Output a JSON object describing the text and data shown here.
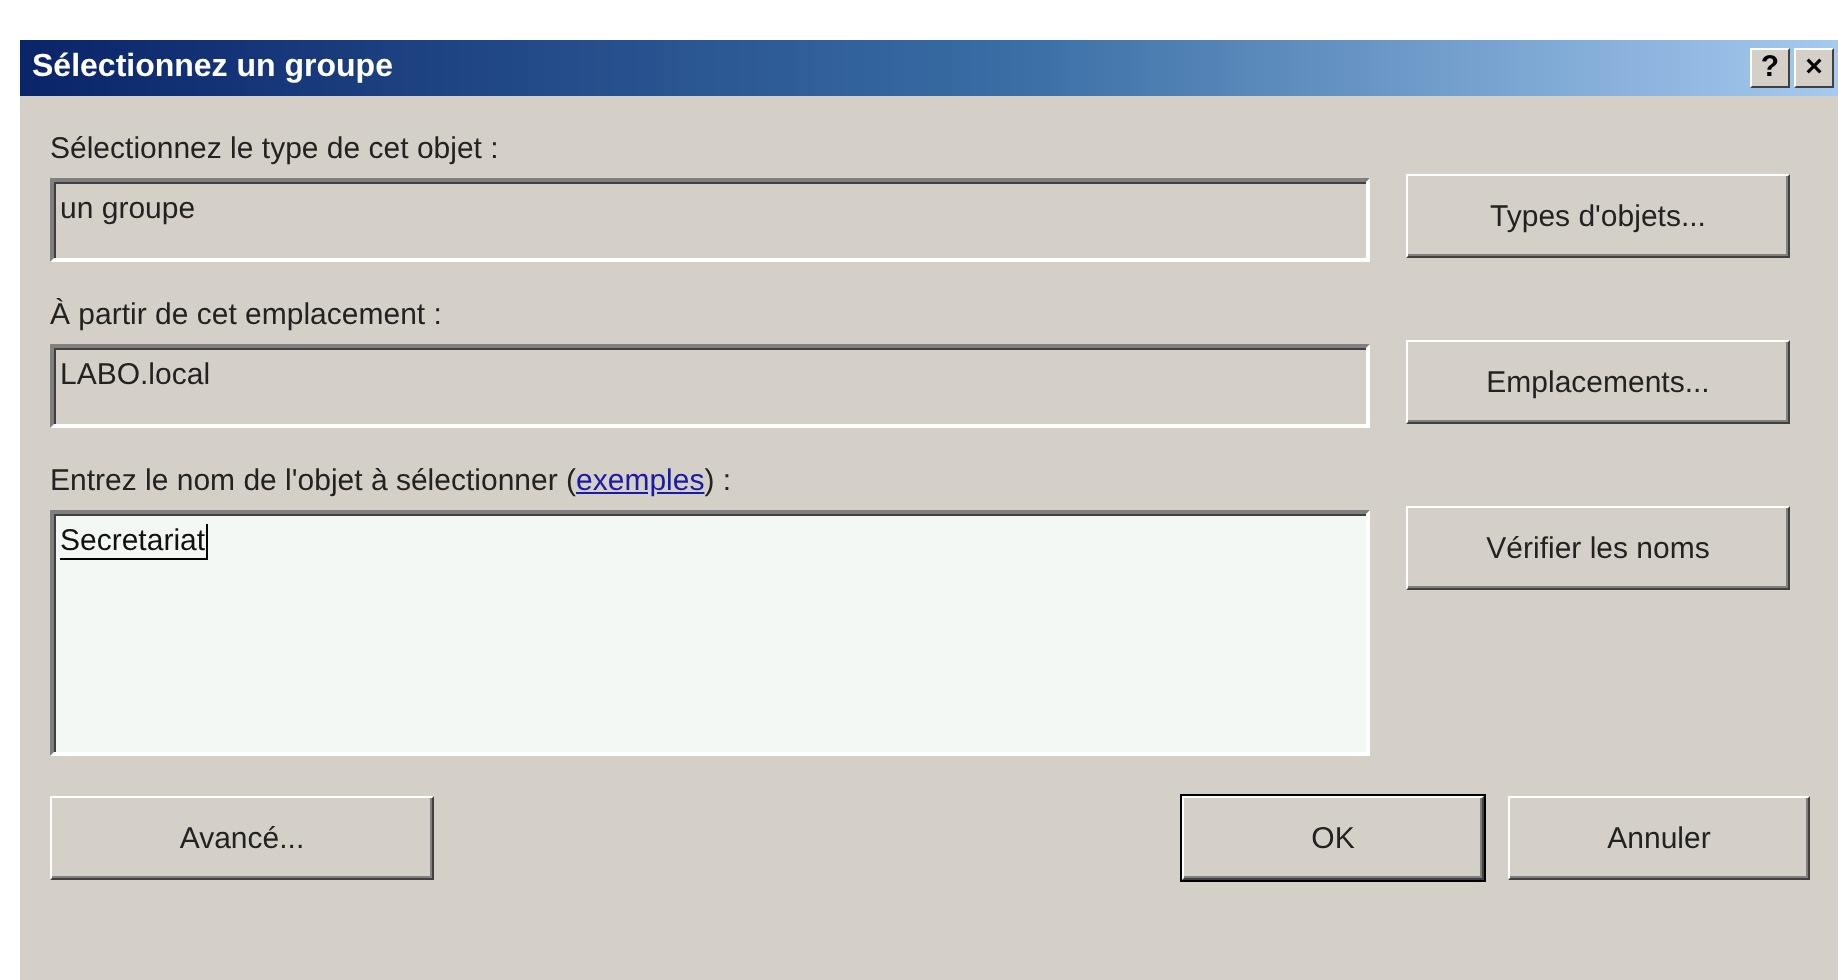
{
  "window": {
    "title": "Sélectionnez un groupe",
    "title_buttons": [
      "?",
      "×"
    ]
  },
  "sections": [
    {
      "label": "Sélectionnez le type de cet objet :",
      "field": {
        "kind": "readonly",
        "value": "un groupe"
      },
      "button": "Types d'objets..."
    },
    {
      "label": "À partir de cet emplacement :",
      "field": {
        "kind": "readonly",
        "value": "LABO.local"
      },
      "button": "Emplacements..."
    },
    {
      "label": "Entrez le nom de l'objet à sélectionner (",
      "link": "exemples",
      "label_end": ") :",
      "field": {
        "kind": "multiline",
        "value": "Secretariat"
      },
      "button": "Vérifier les noms"
    }
  ],
  "buttons": [
    {
      "label": "Avancé...",
      "default": false
    },
    {
      "label": "OK",
      "default": true
    },
    {
      "label": "Annuler",
      "default": false
    }
  ]
}
